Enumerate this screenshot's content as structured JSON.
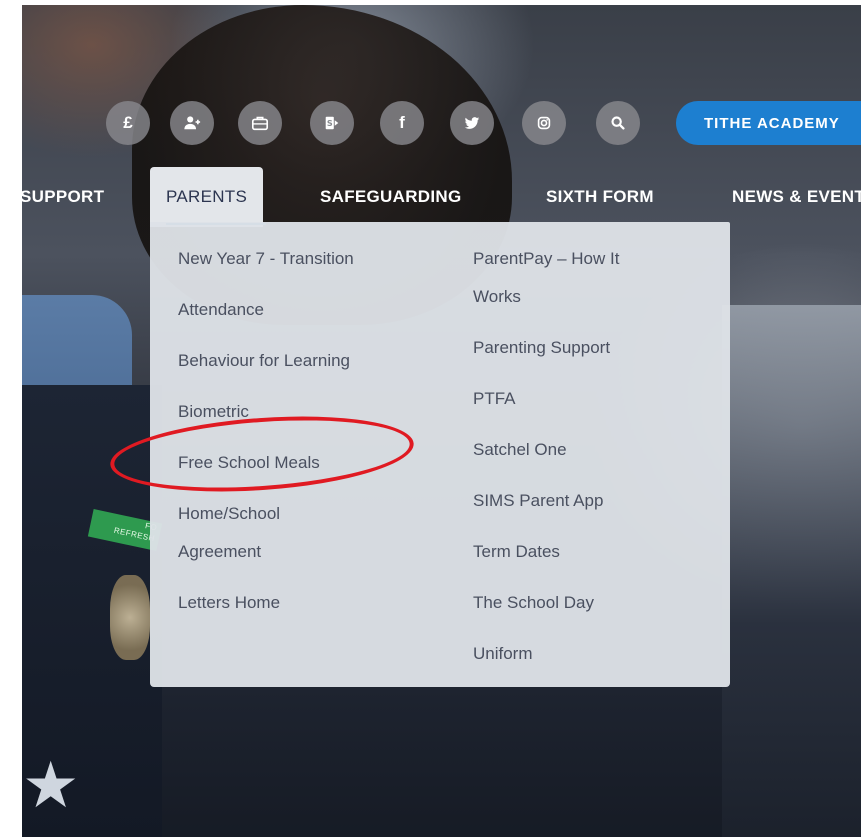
{
  "icons": [
    {
      "name": "pound-icon",
      "glyph": "£"
    },
    {
      "name": "add-user-icon",
      "glyph": ""
    },
    {
      "name": "briefcase-icon",
      "glyph": ""
    },
    {
      "name": "sharepoint-icon",
      "glyph": ""
    },
    {
      "name": "facebook-icon",
      "glyph": "f"
    },
    {
      "name": "twitter-icon",
      "glyph": ""
    },
    {
      "name": "instagram-icon",
      "glyph": ""
    },
    {
      "name": "search-icon",
      "glyph": ""
    }
  ],
  "cta": {
    "label": "TITHE ACADEMY"
  },
  "nav": {
    "items": [
      {
        "label": "SUPPORT"
      },
      {
        "label": "PARENTS"
      },
      {
        "label": "SAFEGUARDING"
      },
      {
        "label": "SIXTH FORM"
      },
      {
        "label": "NEWS & EVENTS"
      }
    ]
  },
  "dropdown": {
    "left": [
      {
        "label": "New Year 7 - Transition"
      },
      {
        "label": "Attendance"
      },
      {
        "label": "Behaviour for Learning"
      },
      {
        "label": "Biometric"
      },
      {
        "label": "Free School Meals"
      },
      {
        "label": "Home/School Agreement"
      },
      {
        "label": "Letters Home"
      }
    ],
    "right": [
      {
        "label": "ParentPay – How It Works"
      },
      {
        "label": "Parenting Support"
      },
      {
        "label": "PTFA"
      },
      {
        "label": "Satchel One"
      },
      {
        "label": "SIMS Parent App"
      },
      {
        "label": "Term Dates"
      },
      {
        "label": "The School Day"
      },
      {
        "label": "Uniform"
      }
    ]
  },
  "badge": {
    "text": "FO\nREFRESH"
  },
  "colors": {
    "accent": "#1d7fd0",
    "highlight": "#e01a22",
    "dropdown_bg": "#dee2e7"
  }
}
